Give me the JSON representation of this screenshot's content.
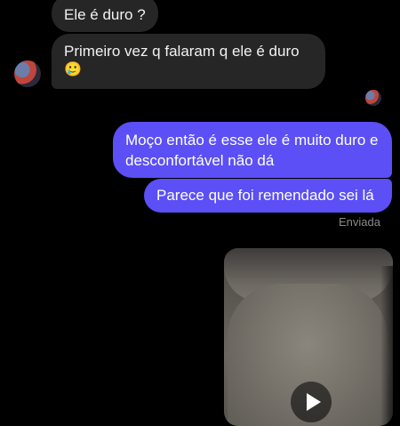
{
  "messages": [
    {
      "text": "Ele é duro ?",
      "direction": "incoming"
    },
    {
      "text": "Primeiro vez q falaram q ele é duro",
      "emoji": "🥲",
      "direction": "incoming"
    },
    {
      "text": "Moço então é esse ele é muito duro e desconfortável não dá",
      "direction": "outgoing"
    },
    {
      "text": "Parece que foi remendado sei lá",
      "direction": "outgoing"
    }
  ],
  "status_text": "Enviada",
  "media": {
    "type": "video",
    "icon": "play-icon"
  },
  "colors": {
    "background": "#000000",
    "incoming_bubble": "#262626",
    "outgoing_bubble": "#5b4ff5",
    "status": "#8a8a8a"
  }
}
